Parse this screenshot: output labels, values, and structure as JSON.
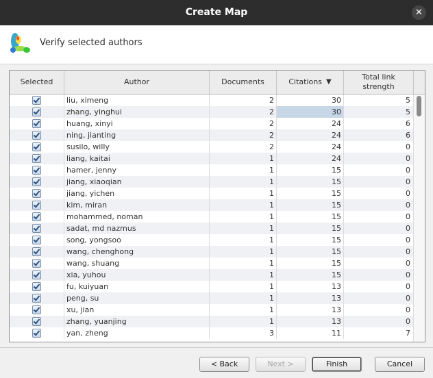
{
  "window": {
    "title": "Create Map",
    "close_glyph": "✕"
  },
  "header": {
    "text": "Verify selected authors",
    "logo_icon": "vosviewer-logo-icon"
  },
  "table": {
    "columns": {
      "selected": "Selected",
      "author": "Author",
      "documents": "Documents",
      "citations": "Citations",
      "total_link_strength": "Total link strength"
    },
    "sorted_column": "citations",
    "sort_glyph": "⌄",
    "rows": [
      {
        "selected": true,
        "author": "liu, ximeng",
        "documents": "2",
        "citations": "30",
        "total_link_strength": "5"
      },
      {
        "selected": true,
        "author": "zhang, yinghui",
        "documents": "2",
        "citations": "30",
        "total_link_strength": "5"
      },
      {
        "selected": true,
        "author": "huang, xinyi",
        "documents": "2",
        "citations": "24",
        "total_link_strength": "6"
      },
      {
        "selected": true,
        "author": "ning, jianting",
        "documents": "2",
        "citations": "24",
        "total_link_strength": "6"
      },
      {
        "selected": true,
        "author": "susilo, willy",
        "documents": "2",
        "citations": "24",
        "total_link_strength": "0"
      },
      {
        "selected": true,
        "author": "liang, kaitai",
        "documents": "1",
        "citations": "24",
        "total_link_strength": "0"
      },
      {
        "selected": true,
        "author": "hamer, jenny",
        "documents": "1",
        "citations": "15",
        "total_link_strength": "0"
      },
      {
        "selected": true,
        "author": "jiang, xiaoqian",
        "documents": "1",
        "citations": "15",
        "total_link_strength": "0"
      },
      {
        "selected": true,
        "author": "jiang, yichen",
        "documents": "1",
        "citations": "15",
        "total_link_strength": "0"
      },
      {
        "selected": true,
        "author": "kim, miran",
        "documents": "1",
        "citations": "15",
        "total_link_strength": "0"
      },
      {
        "selected": true,
        "author": "mohammed, noman",
        "documents": "1",
        "citations": "15",
        "total_link_strength": "0"
      },
      {
        "selected": true,
        "author": "sadat, md nazmus",
        "documents": "1",
        "citations": "15",
        "total_link_strength": "0"
      },
      {
        "selected": true,
        "author": "song, yongsoo",
        "documents": "1",
        "citations": "15",
        "total_link_strength": "0"
      },
      {
        "selected": true,
        "author": "wang, chenghong",
        "documents": "1",
        "citations": "15",
        "total_link_strength": "0"
      },
      {
        "selected": true,
        "author": "wang, shuang",
        "documents": "1",
        "citations": "15",
        "total_link_strength": "0"
      },
      {
        "selected": true,
        "author": "xia, yuhou",
        "documents": "1",
        "citations": "15",
        "total_link_strength": "0"
      },
      {
        "selected": true,
        "author": "fu, kuiyuan",
        "documents": "1",
        "citations": "13",
        "total_link_strength": "0"
      },
      {
        "selected": true,
        "author": "peng, su",
        "documents": "1",
        "citations": "13",
        "total_link_strength": "0"
      },
      {
        "selected": true,
        "author": "xu, jian",
        "documents": "1",
        "citations": "13",
        "total_link_strength": "0"
      },
      {
        "selected": true,
        "author": "zhang, yuanjing",
        "documents": "1",
        "citations": "13",
        "total_link_strength": "0"
      },
      {
        "selected": true,
        "author": "yan, zheng",
        "documents": "3",
        "citations": "11",
        "total_link_strength": "7"
      }
    ],
    "highlighted_cell": {
      "row": 1,
      "column": "citations"
    }
  },
  "buttons": {
    "back": "< Back",
    "next": "Next >",
    "finish": "Finish",
    "cancel": "Cancel"
  },
  "colors": {
    "titlebar": "#2d2d2d",
    "highlight": "#c7d7e8",
    "row_alt": "#f0f1f4"
  }
}
